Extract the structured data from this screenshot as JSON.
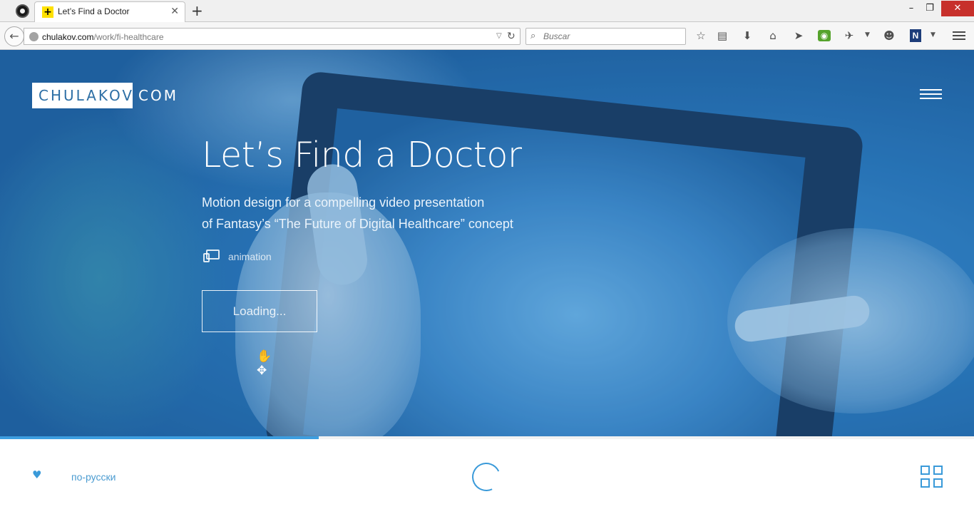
{
  "browser": {
    "tab_title": "Let’s Find a Doctor",
    "tab_close": "✕",
    "new_tab": "+",
    "window_controls": {
      "minimize": "–",
      "restore": "❐",
      "close": "✕"
    },
    "back": "←",
    "url_domain": "chulakov.com",
    "url_path": "/work/fi-healthcare",
    "search_placeholder": "Buscar",
    "toolbar_icons": [
      "bookmark-star-icon",
      "reading-list-icon",
      "download-icon",
      "home-icon",
      "send-icon",
      "screenshot-camera-icon",
      "extension-icon",
      "chat-icon",
      "onenote-icon",
      "menu-icon"
    ]
  },
  "site": {
    "logo_main": "CHULAKOV",
    "logo_suffix": "COM",
    "title": "Let’s Find a Doctor",
    "subtitle_line1": "Motion design for a compelling video presentation",
    "subtitle_line2": "of Fantasy’s “The Future of Digital Healthcare” concept",
    "tag": "animation",
    "loading_button": "Loading...",
    "progress_percent": 32.7,
    "lang_link": "по-русски"
  },
  "colors": {
    "accent": "#3a9ad9",
    "logo_text": "#2d6fa5",
    "progress": "#3d9ee0"
  }
}
